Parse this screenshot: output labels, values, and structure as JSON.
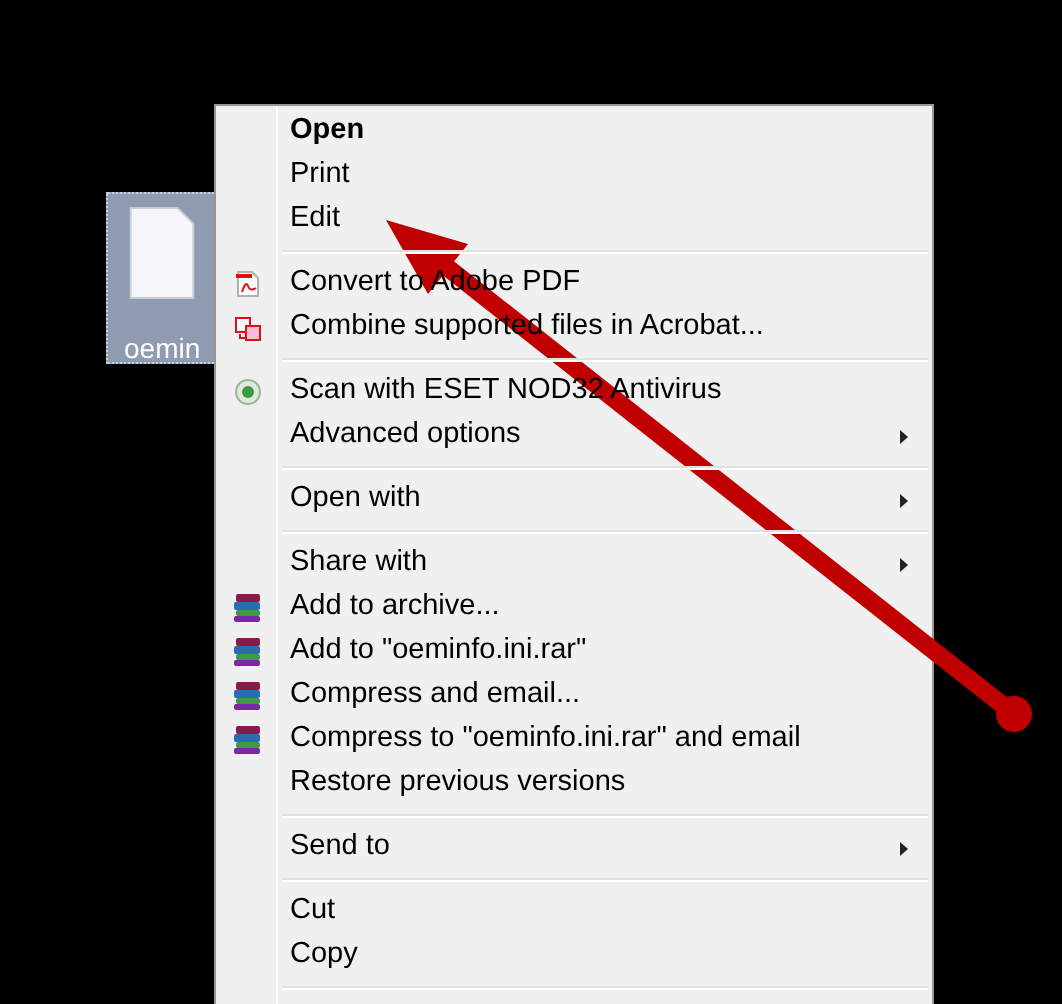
{
  "desktop_icon": {
    "label": "oemin",
    "selected": true
  },
  "menu": [
    {
      "kind": "plain",
      "label": "Open",
      "default": true,
      "submenu": false
    },
    {
      "kind": "plain",
      "label": "Print",
      "default": false,
      "submenu": false
    },
    {
      "kind": "plain",
      "label": "Edit",
      "default": false,
      "submenu": false
    },
    {
      "kind": "separator"
    },
    {
      "kind": "pdf",
      "label": "Convert to Adobe PDF",
      "default": false,
      "submenu": false
    },
    {
      "kind": "pdf-combine",
      "label": "Combine supported files in Acrobat...",
      "default": false,
      "submenu": false
    },
    {
      "kind": "separator"
    },
    {
      "kind": "scan",
      "label": "Scan with ESET NOD32 Antivirus",
      "default": false,
      "submenu": false
    },
    {
      "kind": "plain",
      "label": "Advanced options",
      "default": false,
      "submenu": true
    },
    {
      "kind": "separator"
    },
    {
      "kind": "plain",
      "label": "Open with",
      "default": false,
      "submenu": true
    },
    {
      "kind": "separator"
    },
    {
      "kind": "plain",
      "label": "Share with",
      "default": false,
      "submenu": true
    },
    {
      "kind": "archive",
      "label": "Add to archive...",
      "default": false,
      "submenu": false
    },
    {
      "kind": "archive",
      "label": "Add to \"oeminfo.ini.rar\"",
      "default": false,
      "submenu": false
    },
    {
      "kind": "archive",
      "label": "Compress and email...",
      "default": false,
      "submenu": false
    },
    {
      "kind": "archive",
      "label": "Compress to \"oeminfo.ini.rar\" and email",
      "default": false,
      "submenu": false
    },
    {
      "kind": "plain",
      "label": "Restore previous versions",
      "default": false,
      "submenu": false
    },
    {
      "kind": "separator"
    },
    {
      "kind": "plain",
      "label": "Send to",
      "default": false,
      "submenu": true
    },
    {
      "kind": "separator"
    },
    {
      "kind": "plain",
      "label": "Cut",
      "default": false,
      "submenu": false
    },
    {
      "kind": "plain",
      "label": "Copy",
      "default": false,
      "submenu": false
    },
    {
      "kind": "separator"
    }
  ]
}
